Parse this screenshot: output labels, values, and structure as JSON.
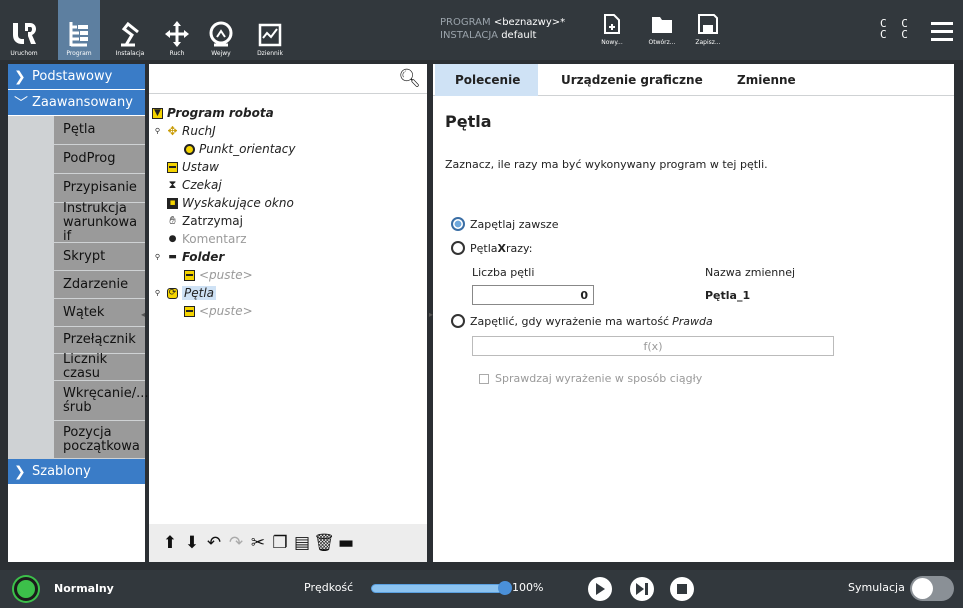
{
  "nav": {
    "buttons": [
      {
        "label": "Uruchom",
        "icon": "ur-logo-icon"
      },
      {
        "label": "Program",
        "icon": "program-icon"
      },
      {
        "label": "Instalacja",
        "icon": "robot-arm-icon"
      },
      {
        "label": "Ruch",
        "icon": "move-icon"
      },
      {
        "label": "Wejwy",
        "icon": "io-icon"
      },
      {
        "label": "Dziennik",
        "icon": "log-icon"
      }
    ]
  },
  "program_info": {
    "program_key": "PROGRAM",
    "program_value": "<beznazwy>*",
    "install_key": "INSTALACJA",
    "install_value": "default"
  },
  "file_buttons": [
    {
      "label": "Nowy..."
    },
    {
      "label": "Otwórz..."
    },
    {
      "label": "Zapisz..."
    }
  ],
  "cc": {
    "line1": "C C",
    "line2": "C C"
  },
  "categories": [
    {
      "label": "Podstawowy"
    },
    {
      "label": "Zaawansowany"
    },
    {
      "label": "Szablony"
    }
  ],
  "advanced_items": [
    "Pętla",
    "PodProg",
    "Przypisanie",
    "Instrukcja warunkowa if",
    "Skrypt",
    "Zdarzenie",
    "Wątek",
    "Przełącznik",
    "Licznik czasu",
    "Wkręcanie/... śrub",
    "Pozycja początkowa"
  ],
  "tree": {
    "root": "Program robota",
    "ruchj": "RuchJ",
    "waypoint": "Punkt_orientacy",
    "ustaw": "Ustaw",
    "czekaj": "Czekaj",
    "popup": "Wyskakujące okno",
    "zatrzymaj": "Zatrzymaj",
    "komentarz": "Komentarz",
    "folder": "Folder",
    "empty1": "<puste>",
    "petla": "Pętla",
    "empty2": "<puste>"
  },
  "tabs": [
    "Polecenie",
    "Urządzenie graficzne",
    "Zmienne"
  ],
  "main": {
    "title": "Pętla",
    "description": "Zaznacz, ile razy ma być wykonywany program w tej pętli.",
    "opt_always": "Zapętlaj zawsze",
    "opt_times_a": "Pętla ",
    "opt_times_x": "X",
    "opt_times_b": " razy:",
    "count_label": "Liczba pętli",
    "count_value": "0",
    "varname_label": "Nazwa zmiennej",
    "varname_value": "Pętla_1",
    "opt_expr": "Zapętlić, gdy wyrażenie ma wartość ",
    "opt_expr_italic": "Prawda",
    "expr_placeholder": "f(x)",
    "continuous": "Sprawdzaj wyrażenie w sposób ciągły"
  },
  "status": {
    "label": "Normalny",
    "color": "#3cc04a"
  },
  "speed": {
    "label": "Prędkość",
    "value": "100%"
  },
  "sim": {
    "label": "Symulacja"
  },
  "colors": {
    "accent": "#3a7cc7",
    "topbar": "#32383d"
  }
}
